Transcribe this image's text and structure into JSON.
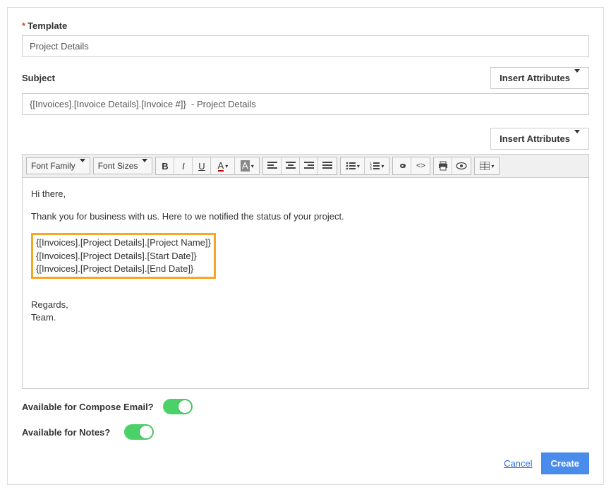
{
  "template": {
    "label": "Template",
    "value": "Project Details"
  },
  "subject": {
    "label": "Subject",
    "value": "{[Invoices].[Invoice Details].[Invoice #]}  - Project Details"
  },
  "insert_attributes": "Insert Attributes",
  "toolbar": {
    "font_family": "Font Family",
    "font_sizes": "Font Sizes"
  },
  "editor": {
    "greeting": "Hi there,",
    "intro": "Thank you for business with us. Here to we notified the status of your project.",
    "vars": [
      "{[Invoices].[Project Details].[Project Name]}",
      "{[Invoices].[Project Details].[Start Date]}",
      "{[Invoices].[Project Details].[End Date]}"
    ],
    "sign1": "Regards,",
    "sign2": "Team."
  },
  "compose": {
    "label": "Available for Compose Email?"
  },
  "notes": {
    "label": "Available for Notes?"
  },
  "footer": {
    "cancel": "Cancel",
    "create": "Create"
  }
}
